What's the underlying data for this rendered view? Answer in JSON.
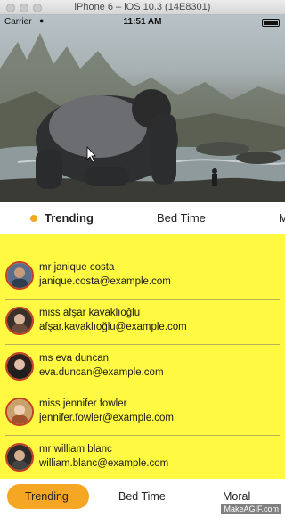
{
  "window": {
    "title": "iPhone 6 – iOS 10.3 (14E8301)"
  },
  "status_bar": {
    "carrier": "Carrier",
    "time": "11:51 AM"
  },
  "top_tabs": [
    {
      "label": "Trending",
      "active": true
    },
    {
      "label": "Bed Time",
      "active": false
    },
    {
      "label": "M",
      "active": false
    }
  ],
  "users": [
    {
      "name": "mr janique costa",
      "email": "janique.costa@example.com"
    },
    {
      "name": "miss afşar kavaklıoğlu",
      "email": "afşar.kavaklıoğlu@example.com"
    },
    {
      "name": "ms eva duncan",
      "email": "eva.duncan@example.com"
    },
    {
      "name": "miss jennifer fowler",
      "email": "jennifer.fowler@example.com"
    },
    {
      "name": "mr william blanc",
      "email": "william.blanc@example.com"
    }
  ],
  "bottom_tabs": [
    {
      "label": "Trending",
      "active": true
    },
    {
      "label": "Bed Time",
      "active": false
    },
    {
      "label": "Moral",
      "active": false
    }
  ],
  "watermark": "MakeAGIF.com",
  "colors": {
    "accent": "#f5a623",
    "list_background": "#fff941",
    "avatar_border": "#c2402a"
  }
}
